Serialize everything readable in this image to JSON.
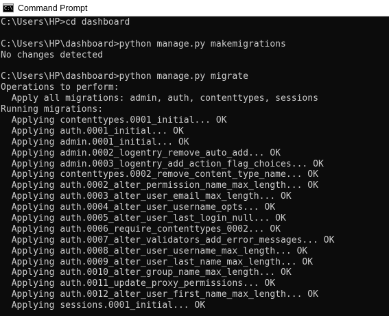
{
  "window": {
    "title": "Command Prompt",
    "icon": "cmd-icon",
    "icon_glyph": "C:\\"
  },
  "colors": {
    "background": "#0c0c0c",
    "text": "#cccccc",
    "titlebar": "#ffffff"
  },
  "console": {
    "lines": [
      "C:\\Users\\HP>cd dashboard",
      "",
      "C:\\Users\\HP\\dashboard>python manage.py makemigrations",
      "No changes detected",
      "",
      "C:\\Users\\HP\\dashboard>python manage.py migrate",
      "Operations to perform:",
      "  Apply all migrations: admin, auth, contenttypes, sessions",
      "Running migrations:",
      "  Applying contenttypes.0001_initial... OK",
      "  Applying auth.0001_initial... OK",
      "  Applying admin.0001_initial... OK",
      "  Applying admin.0002_logentry_remove_auto_add... OK",
      "  Applying admin.0003_logentry_add_action_flag_choices... OK",
      "  Applying contenttypes.0002_remove_content_type_name... OK",
      "  Applying auth.0002_alter_permission_name_max_length... OK",
      "  Applying auth.0003_alter_user_email_max_length... OK",
      "  Applying auth.0004_alter_user_username_opts... OK",
      "  Applying auth.0005_alter_user_last_login_null... OK",
      "  Applying auth.0006_require_contenttypes_0002... OK",
      "  Applying auth.0007_alter_validators_add_error_messages... OK",
      "  Applying auth.0008_alter_user_username_max_length... OK",
      "  Applying auth.0009_alter_user_last_name_max_length... OK",
      "  Applying auth.0010_alter_group_name_max_length... OK",
      "  Applying auth.0011_update_proxy_permissions... OK",
      "  Applying auth.0012_alter_user_first_name_max_length... OK",
      "  Applying sessions.0001_initial... OK"
    ]
  }
}
